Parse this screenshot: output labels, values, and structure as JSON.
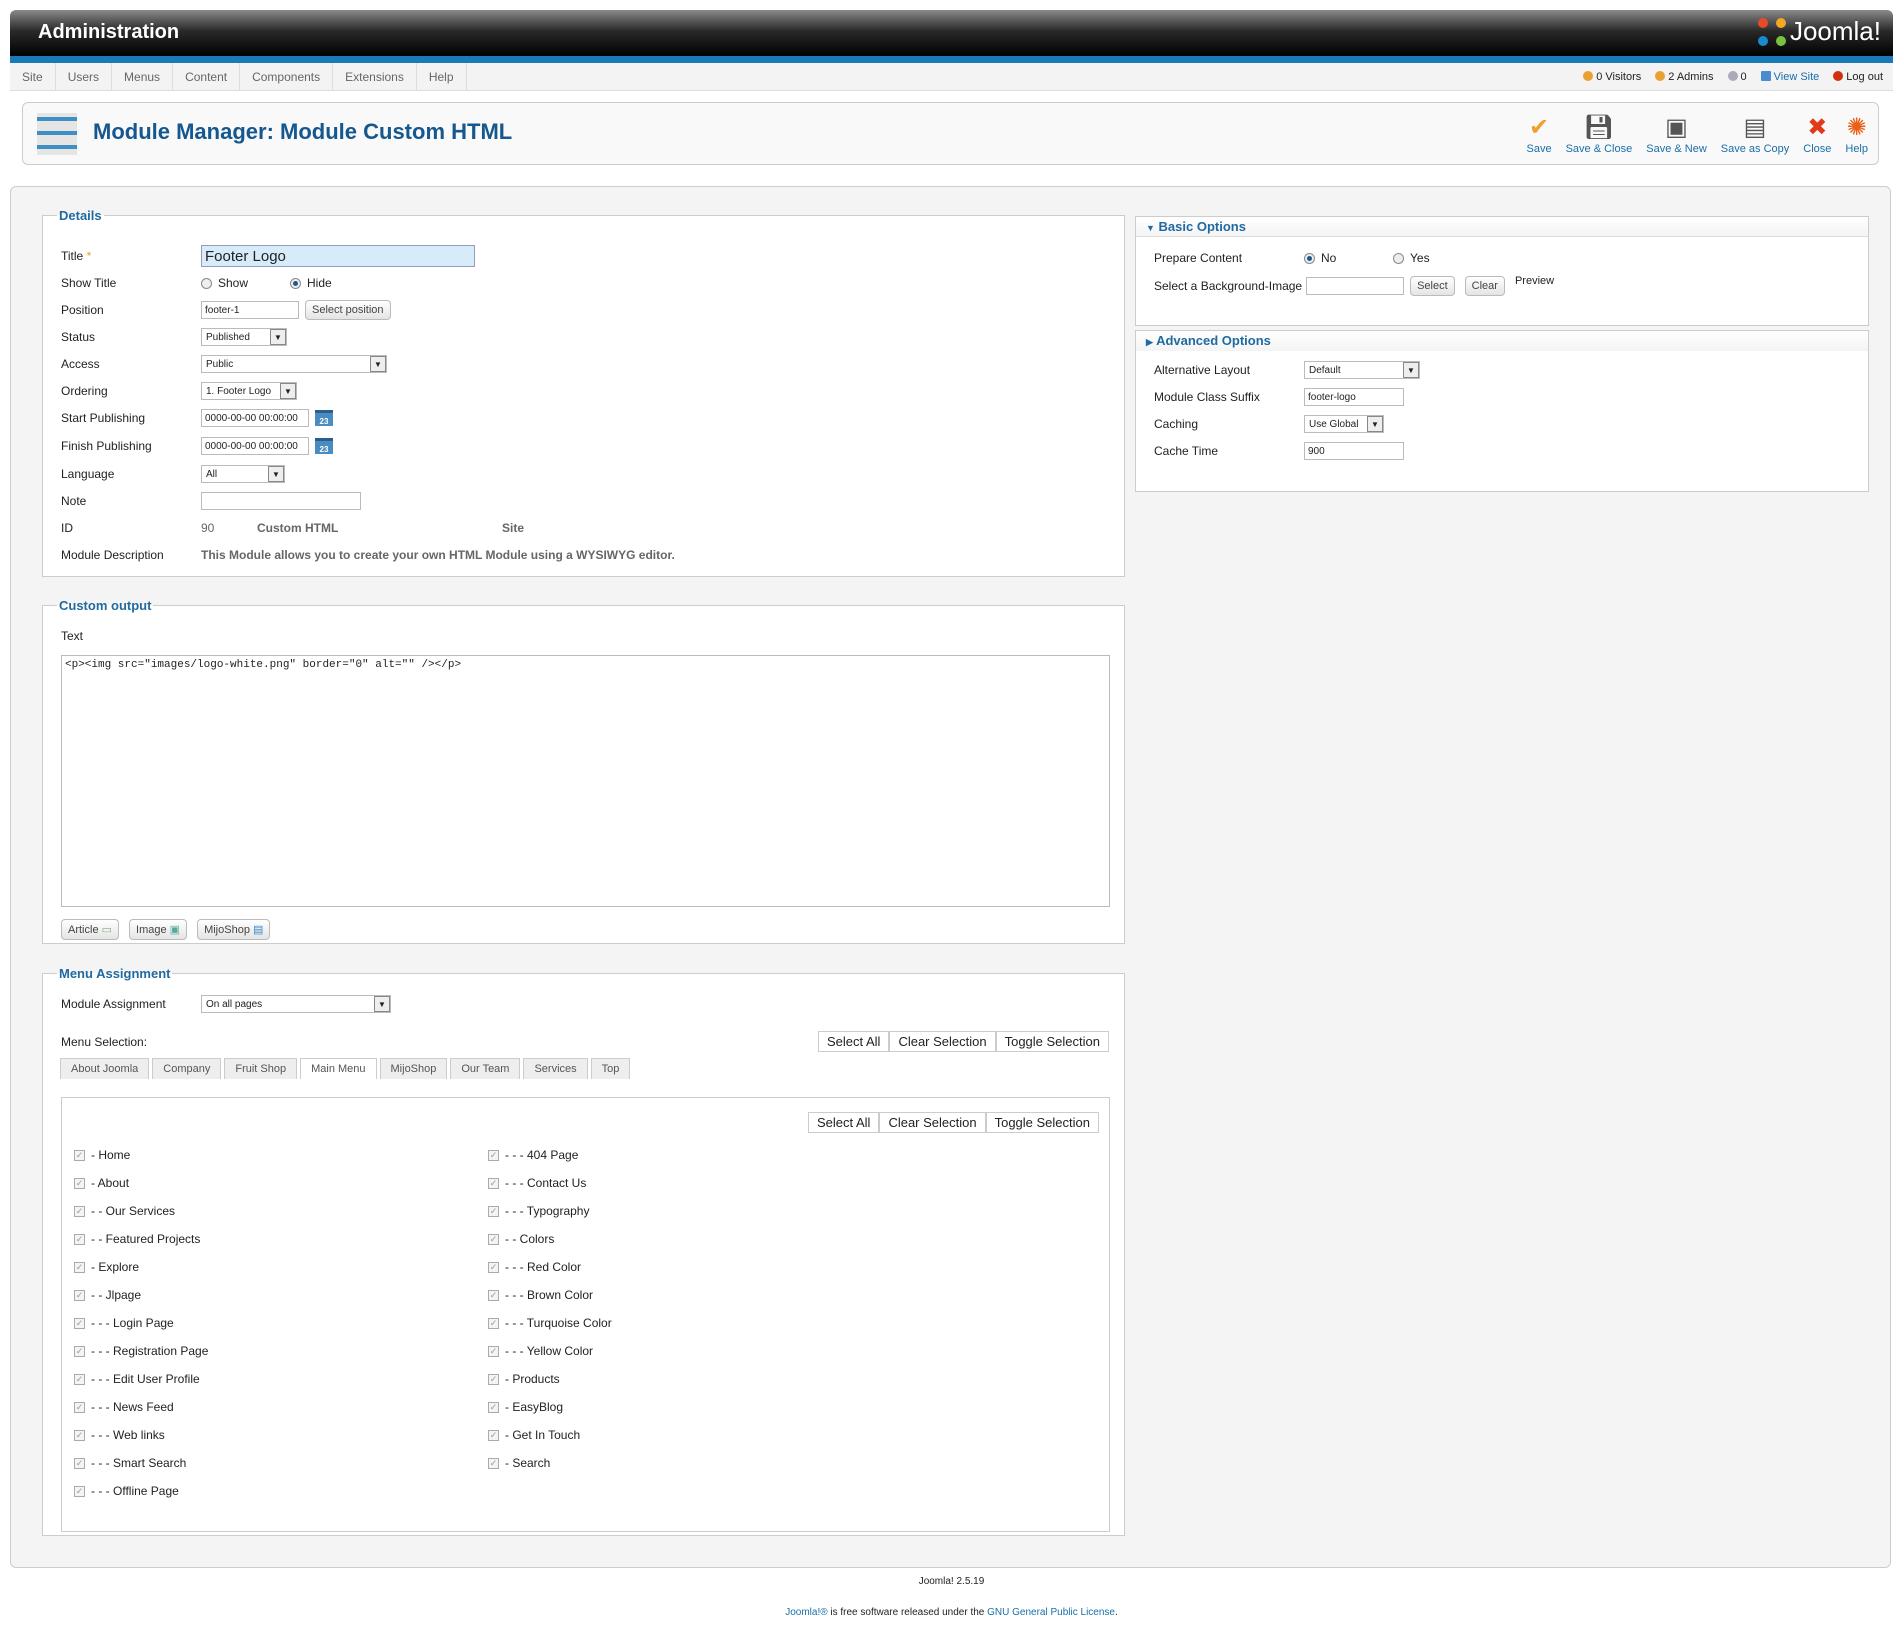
{
  "header": {
    "title": "Administration",
    "logo_text": "Joomla!"
  },
  "menu": [
    "Site",
    "Users",
    "Menus",
    "Content",
    "Components",
    "Extensions",
    "Help"
  ],
  "status": {
    "visitors": "0 Visitors",
    "admins": "2 Admins",
    "messages": "0",
    "view_site": "View Site",
    "logout": "Log out"
  },
  "toolbar": {
    "title": "Module Manager: Module Custom HTML",
    "buttons": [
      {
        "label": "Save",
        "icon": "check-icon",
        "color": "#f0a030"
      },
      {
        "label": "Save & Close",
        "icon": "floppy-icon",
        "color": "#555"
      },
      {
        "label": "Save & New",
        "icon": "floppy-new-icon",
        "color": "#555"
      },
      {
        "label": "Save as Copy",
        "icon": "floppy-copy-icon",
        "color": "#555"
      },
      {
        "label": "Close",
        "icon": "close-icon",
        "color": "#e03a1a"
      },
      {
        "label": "Help",
        "icon": "lifebuoy-icon",
        "color": "#e8601a"
      }
    ]
  },
  "details": {
    "legend": "Details",
    "title_label": "Title",
    "required": "*",
    "title_value": "Footer Logo",
    "show_title_label": "Show Title",
    "show": "Show",
    "hide": "Hide",
    "position_label": "Position",
    "position_value": "footer-1",
    "select_position": "Select position",
    "status_label": "Status",
    "status_value": "Published",
    "access_label": "Access",
    "access_value": "Public",
    "ordering_label": "Ordering",
    "ordering_value": "1. Footer Logo",
    "start_label": "Start Publishing",
    "start_value": "0000-00-00 00:00:00",
    "finish_label": "Finish Publishing",
    "finish_value": "0000-00-00 00:00:00",
    "calendar_day": "23",
    "language_label": "Language",
    "language_value": "All",
    "note_label": "Note",
    "note_value": "",
    "id_label": "ID",
    "id_value": "90",
    "type_value": "Custom HTML",
    "client_value": "Site",
    "desc_label": "Module Description",
    "desc_value": "This Module allows you to create your own HTML Module using a WYSIWYG editor."
  },
  "custom": {
    "legend": "Custom output",
    "text_label": "Text",
    "content": "<p><img src=\"images/logo-white.png\" border=\"0\" alt=\"\" /></p>",
    "buttons": [
      "Article",
      "Image",
      "MijoShop"
    ]
  },
  "basic": {
    "title": "Basic Options",
    "prepare_label": "Prepare Content",
    "no": "No",
    "yes": "Yes",
    "bg_label": "Select a Background-Image",
    "bg_value": "",
    "select": "Select",
    "clear": "Clear",
    "preview": "Preview"
  },
  "advanced": {
    "title": "Advanced Options",
    "layout_label": "Alternative Layout",
    "layout_value": "Default",
    "suffix_label": "Module Class Suffix",
    "suffix_value": "footer-logo",
    "caching_label": "Caching",
    "caching_value": "Use Global",
    "cache_time_label": "Cache Time",
    "cache_time_value": "900"
  },
  "assignment": {
    "legend": "Menu Assignment",
    "module_assignment_label": "Module Assignment",
    "module_assignment_value": "On all pages",
    "menu_selection_label": "Menu Selection:",
    "select_all": "Select All",
    "clear_selection": "Clear Selection",
    "toggle_selection": "Toggle Selection",
    "tabs": [
      "About Joomla",
      "Company",
      "Fruit Shop",
      "Main Menu",
      "MijoShop",
      "Our Team",
      "Services",
      "Top"
    ],
    "active_tab": "Main Menu",
    "left_items": [
      "- Home",
      "- About",
      "- - Our Services",
      "- - Featured Projects",
      "- Explore",
      "- - Jlpage",
      "- - - Login Page",
      "- - - Registration Page",
      "- - - Edit User Profile",
      "- - - News Feed",
      "- - - Web links",
      "- - - Smart Search",
      "- - - Offline Page"
    ],
    "right_items": [
      "- - - 404 Page",
      "- - - Contact Us",
      "- - - Typography",
      "- - Colors",
      "- - - Red Color",
      "- - - Brown Color",
      "- - - Turquoise Color",
      "- - - Yellow Color",
      "- Products",
      "- EasyBlog",
      "- Get In Touch",
      "- Search"
    ]
  },
  "footer": {
    "version": "Joomla! 2.5.19",
    "license_pre": "Joomla!®",
    "license_mid": " is free software released under the ",
    "license_link": "GNU General Public License",
    "license_end": "."
  }
}
